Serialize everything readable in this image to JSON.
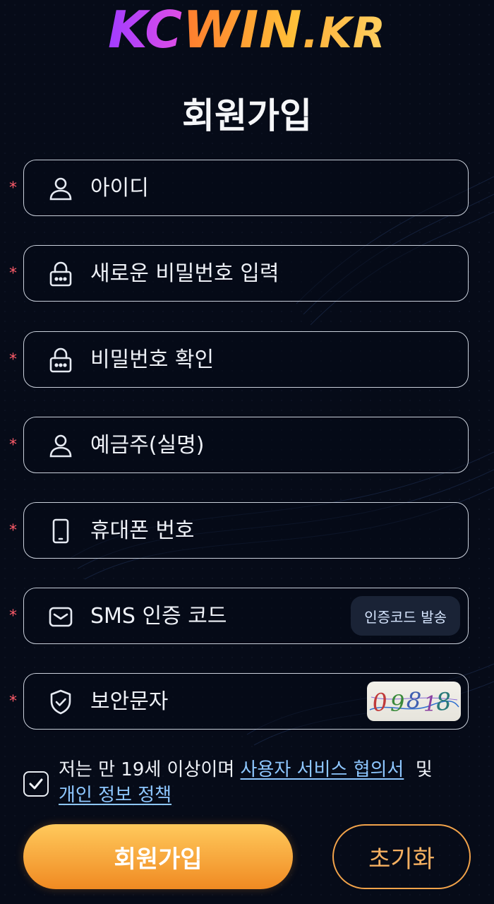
{
  "logo": {
    "part1": "KC",
    "part2": "WIN",
    "part3": ".KR"
  },
  "page_title": "회원가입",
  "form": {
    "required_mark": "*",
    "fields": [
      {
        "icon": "user-icon",
        "placeholder": "아이디",
        "value": ""
      },
      {
        "icon": "lock-icon",
        "placeholder": "새로운 비밀번호 입력",
        "value": ""
      },
      {
        "icon": "lock-icon",
        "placeholder": "비밀번호 확인",
        "value": ""
      },
      {
        "icon": "user-icon",
        "placeholder": "예금주(실명)",
        "value": ""
      },
      {
        "icon": "phone-icon",
        "placeholder": "휴대폰 번호",
        "value": ""
      },
      {
        "icon": "envelope-icon",
        "placeholder": "SMS 인증 코드",
        "value": ""
      },
      {
        "icon": "shield-check-icon",
        "placeholder": "보안문자",
        "value": ""
      }
    ],
    "sms_button_label": "인증코드 발송",
    "captcha_text": "09818"
  },
  "terms": {
    "checked": true,
    "prefix": "저는 만 19세 이상이며 ",
    "link1": "사용자 서비스 협의서",
    "middle": "  및",
    "link2": "개인 정보 정책"
  },
  "buttons": {
    "signup_label": "회원가입",
    "reset_label": "초기화"
  },
  "colors": {
    "background": "#060b18",
    "accent_orange": "#f08a22",
    "link_blue": "#8ec7ff",
    "required_red": "#ff5c6a"
  }
}
